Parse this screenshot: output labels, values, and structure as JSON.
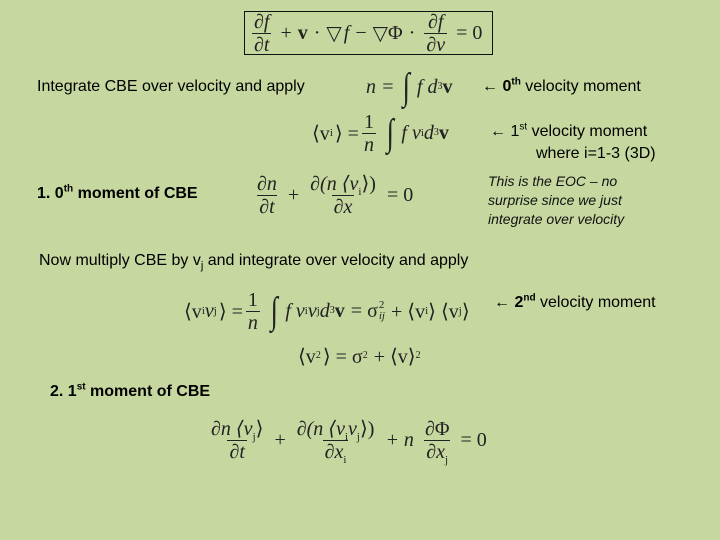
{
  "cbe_equation": {
    "df": "∂f",
    "dt": "∂t",
    "plus": "+",
    "v": "v",
    "dot": "·",
    "nabla": "▽",
    "f": "f",
    "minus": "−",
    "phi": "Φ",
    "dv": "∂v",
    "equals": "= 0"
  },
  "line1": {
    "label": "Integrate CBE over velocity and apply",
    "arrow": "←",
    "ordinal": "0",
    "ordinal_suffix": "th",
    "annotation": "velocity moment"
  },
  "eq_n": {
    "lhs": "n =",
    "integrand": "f d",
    "power": "3",
    "v": "v"
  },
  "line2": {
    "arrow": "←",
    "ordinal": "1",
    "ordinal_suffix": "st",
    "annotation": "velocity moment",
    "note": "where i=1-3 (3D)"
  },
  "eq_vi": {
    "lhs": "⟨v",
    "sub": "i",
    "close": "⟩ =",
    "num": "1",
    "den": "n",
    "integrand": "f v",
    "integrand_sub": "i",
    "d": "d",
    "power": "3",
    "v": "v"
  },
  "section1": {
    "number": "1. 0",
    "suffix": "th",
    "label": "moment of CBE"
  },
  "eq_zeroth": {
    "num1": "∂n",
    "den1": "∂t",
    "plus": "+",
    "num2": "∂(n ⟨v",
    "num2_sub": "i",
    "num2_close": "⟩)",
    "den2": "∂x",
    "equals": "= 0"
  },
  "note_eoc": {
    "lines": [
      "This is the EOC – no",
      "surprise since we just",
      "integrate over velocity"
    ]
  },
  "line3": {
    "text_before": "Now multiply CBE by v",
    "sub": "j",
    "text_after": " and integrate over velocity and apply"
  },
  "eq_vivj": {
    "lhs": "⟨v",
    "lhs_sub1": "i",
    "lhs_mid": "v",
    "lhs_sub2": "j",
    "lhs_close": "⟩ =",
    "num": "1",
    "den": "n",
    "integrand": "f v",
    "isub": "i",
    "v2": "v",
    "jsub": "j",
    "d": "d",
    "power": "3",
    "v": "v",
    "eq": "= σ",
    "sigma_sup": "2",
    "sigma_sub": "ij",
    "plus": "+ ⟨v",
    "rsub1": "i",
    "mid": "⟩ ⟨v",
    "rsub2": "j",
    "close": "⟩"
  },
  "line4": {
    "arrow": "←",
    "ordinal": "2",
    "ordinal_suffix": "nd",
    "annotation": "velocity moment"
  },
  "eq_v2": {
    "lhs": "⟨v",
    "lhs_sup": "2",
    "rhs": "⟩ = σ",
    "sigma_sup": "2",
    "plus": "+ ⟨v⟩",
    "sup": "2"
  },
  "section2": {
    "number": "2. 1",
    "suffix": "st",
    "label": "moment of CBE"
  },
  "eq_first": {
    "num1": "∂n ⟨v",
    "num1_sub": "j",
    "num1_close": "⟩",
    "den1": "∂t",
    "plus1": "+",
    "num2": "∂(n ⟨v",
    "num2_sub1": "i",
    "num2_mid": "v",
    "num2_sub2": "j",
    "num2_close": "⟩)",
    "den2": "∂x",
    "den2_sub": "i",
    "plus2": "+ n",
    "num3": "∂Φ",
    "den3": "∂x",
    "den3_sub": "j",
    "equals": "= 0"
  }
}
